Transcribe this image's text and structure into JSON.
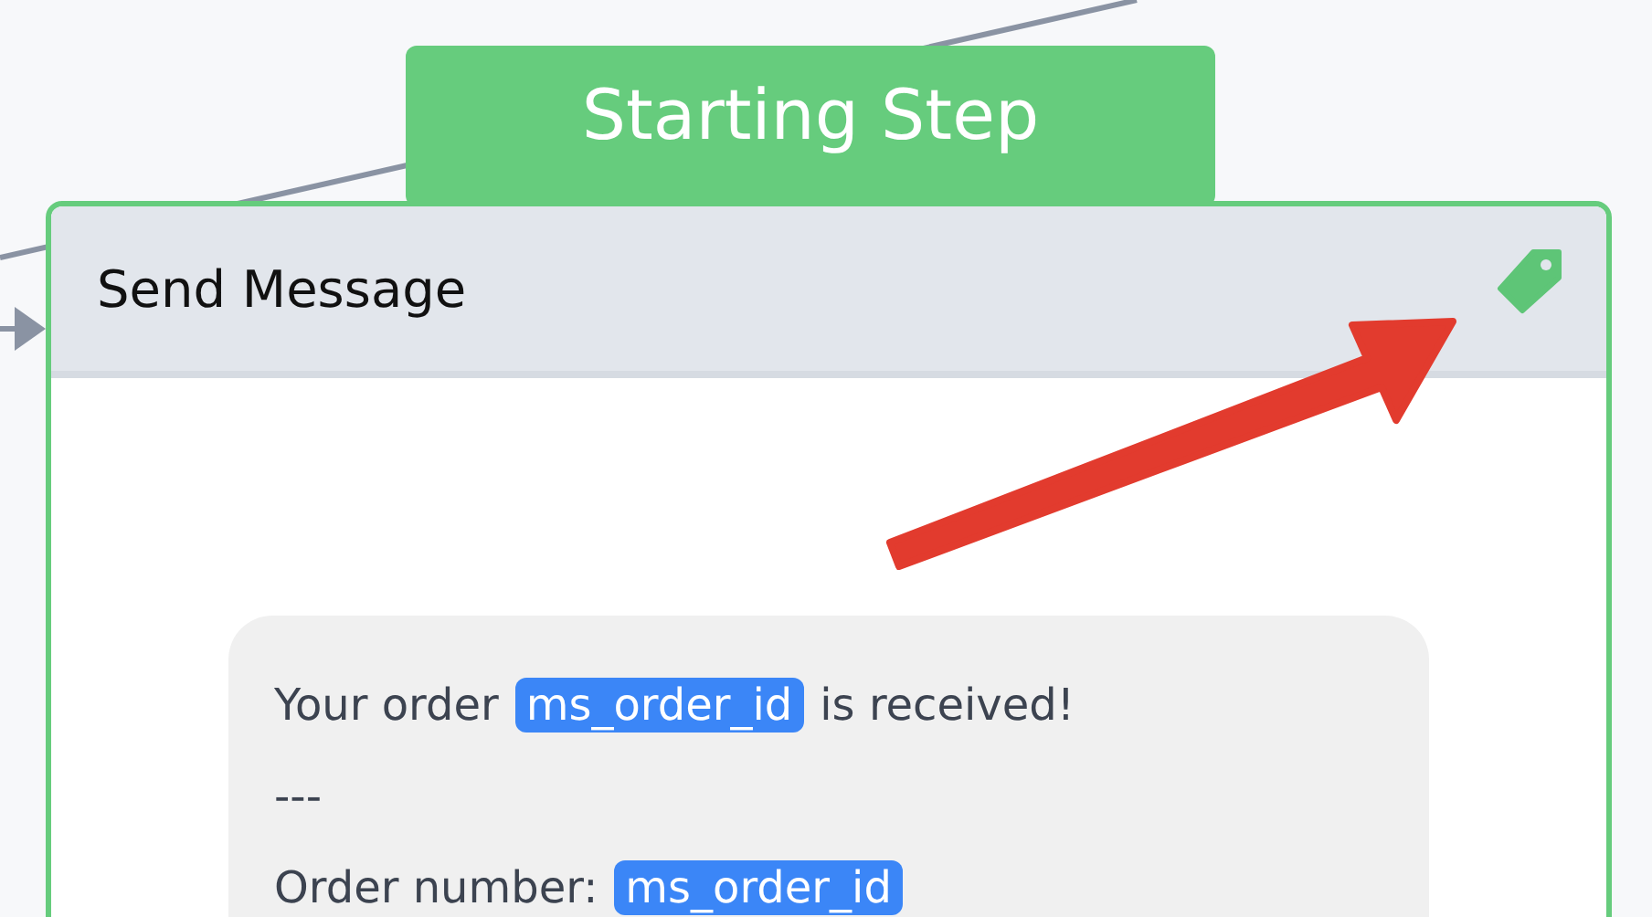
{
  "badge": {
    "label": "Starting Step"
  },
  "node": {
    "title": "Send Message",
    "tagged": true,
    "message_lines": [
      [
        {
          "kind": "text",
          "text": "Your order"
        },
        {
          "kind": "variable",
          "text": "ms_order_id"
        },
        {
          "kind": "text",
          "text": "is received!"
        }
      ],
      [
        {
          "kind": "text",
          "text": "---"
        }
      ],
      [
        {
          "kind": "text",
          "text": "Order number:"
        },
        {
          "kind": "variable",
          "text": "ms_order_id"
        }
      ]
    ]
  }
}
